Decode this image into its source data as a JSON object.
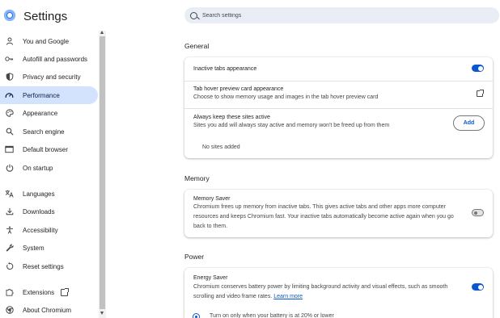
{
  "header": {
    "title": "Settings",
    "search_placeholder": "Search settings"
  },
  "sidebar": {
    "items": [
      {
        "label": "You and Google",
        "icon": "person-icon"
      },
      {
        "label": "Autofill and passwords",
        "icon": "key-icon"
      },
      {
        "label": "Privacy and security",
        "icon": "shield-icon"
      },
      {
        "label": "Performance",
        "icon": "speedometer-icon",
        "active": true
      },
      {
        "label": "Appearance",
        "icon": "palette-icon"
      },
      {
        "label": "Search engine",
        "icon": "search-icon"
      },
      {
        "label": "Default browser",
        "icon": "browser-icon"
      },
      {
        "label": "On startup",
        "icon": "power-icon"
      },
      {
        "label": "Languages",
        "icon": "translate-icon"
      },
      {
        "label": "Downloads",
        "icon": "download-icon"
      },
      {
        "label": "Accessibility",
        "icon": "accessibility-icon"
      },
      {
        "label": "System",
        "icon": "wrench-icon"
      },
      {
        "label": "Reset settings",
        "icon": "reset-icon"
      },
      {
        "label": "Extensions",
        "icon": "puzzle-icon"
      },
      {
        "label": "About Chromium",
        "icon": "chromium-icon"
      }
    ]
  },
  "general": {
    "title": "General",
    "inactive_tabs": {
      "title": "Inactive tabs appearance",
      "enabled": true
    },
    "hover_card": {
      "title": "Tab hover preview card appearance",
      "subtitle": "Choose to show memory usage and images in the tab hover preview card"
    },
    "always_active": {
      "title": "Always keep these sites active",
      "subtitle": "Sites you add will always stay active and memory won't be freed up from them",
      "add_label": "Add",
      "empty_label": "No sites added"
    }
  },
  "memory": {
    "title": "Memory",
    "saver": {
      "title": "Memory Saver",
      "line1": "Chromium frees up memory from inactive tabs. This gives active tabs and other apps more computer",
      "line2": "resources and keeps Chromium fast. Your inactive tabs automatically become active again when you go",
      "line3": "back to them.",
      "enabled": false
    }
  },
  "power": {
    "title": "Power",
    "energy": {
      "title": "Energy Saver",
      "line1": "Chromium conserves battery power by limiting background activity and visual effects, such as smooth",
      "line2": "scrolling and video frame rates.",
      "learn_more": "Learn more",
      "enabled": true,
      "option1": "Turn on only when your battery is at 20% or lower"
    }
  },
  "colors": {
    "accent": "#0b57d0",
    "active_nav": "#d3e3fd",
    "search_bg": "#e9eef6"
  }
}
